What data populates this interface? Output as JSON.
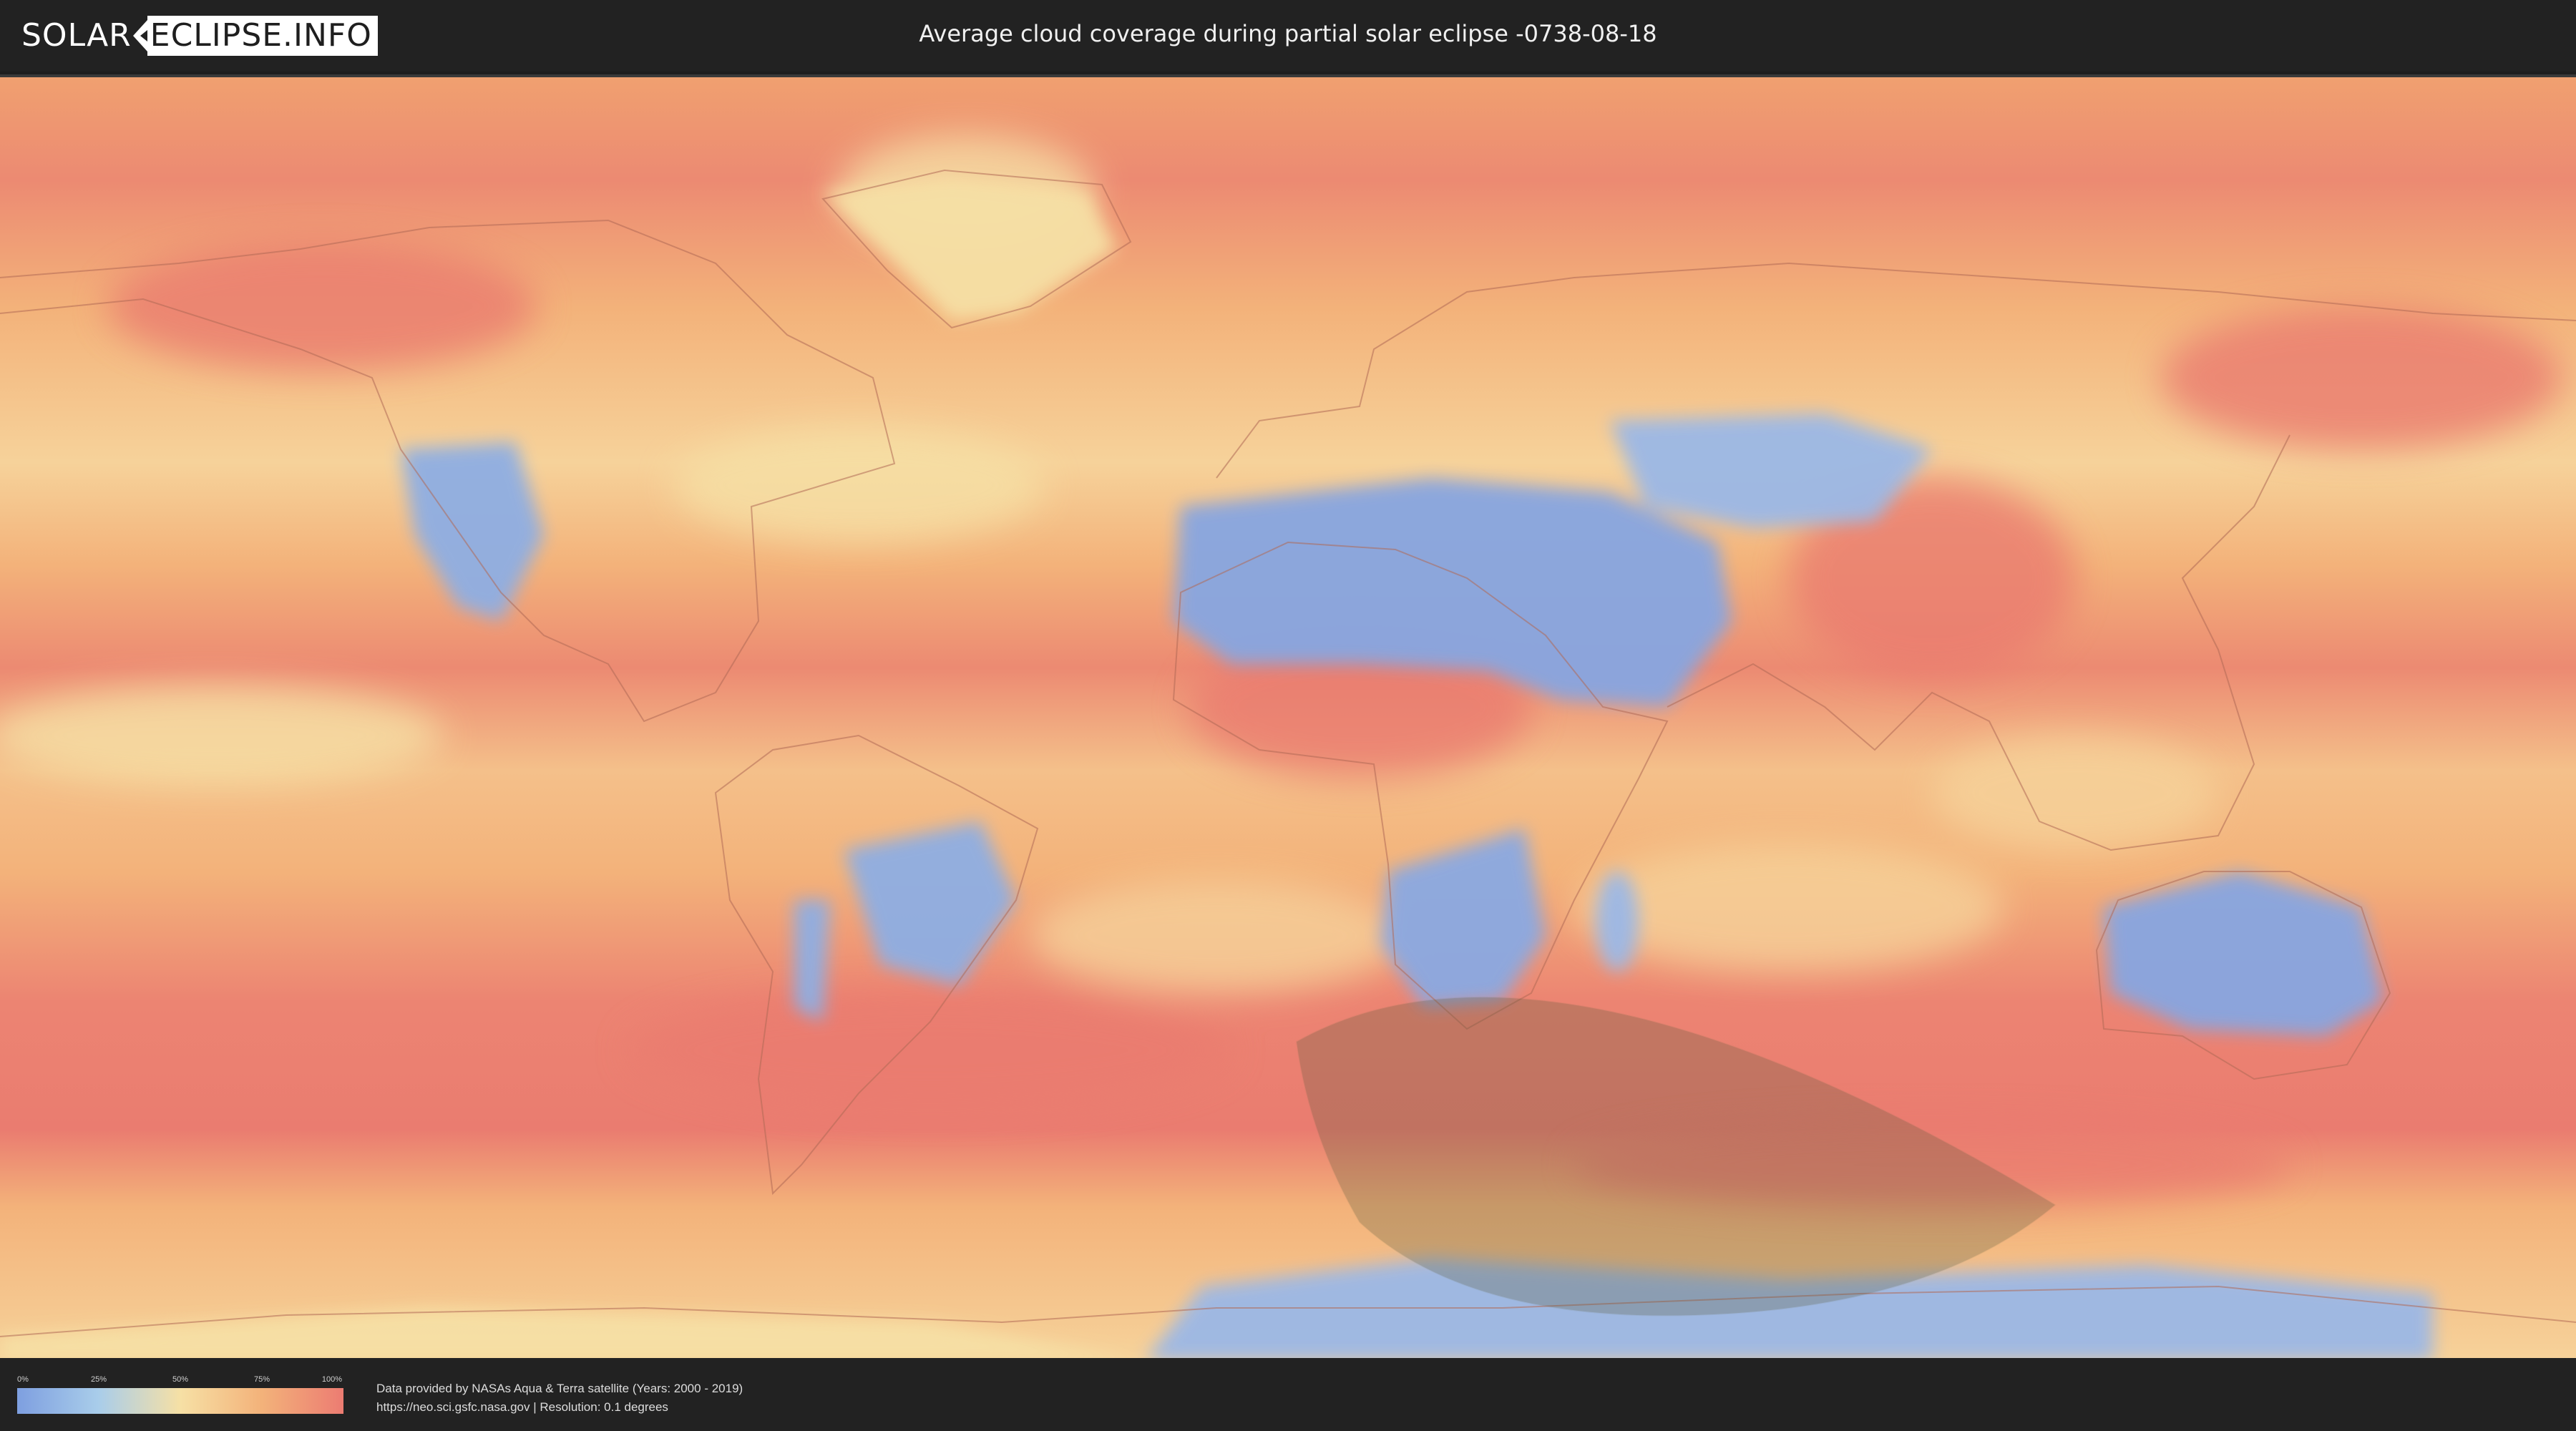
{
  "header": {
    "logo_left": "SOLAR",
    "logo_right": "ECLIPSE.INFO",
    "title": "Average cloud coverage during partial solar eclipse -0738-08-18"
  },
  "legend": {
    "ticks": [
      "0%",
      "25%",
      "50%",
      "75%",
      "100%"
    ],
    "colors": [
      "#7e9fe0",
      "#a9cdea",
      "#f6e0a5",
      "#f3b27a",
      "#ec7c72"
    ]
  },
  "credits": {
    "line1": "Data provided by NASAs Aqua & Terra satellite (Years: 2000 - 2019)",
    "line2": "https://neo.sci.gsfc.nasa.gov | Resolution: 0.1 degrees"
  },
  "map": {
    "layer": "cloud-coverage",
    "overlay": "eclipse-visibility-zone"
  }
}
